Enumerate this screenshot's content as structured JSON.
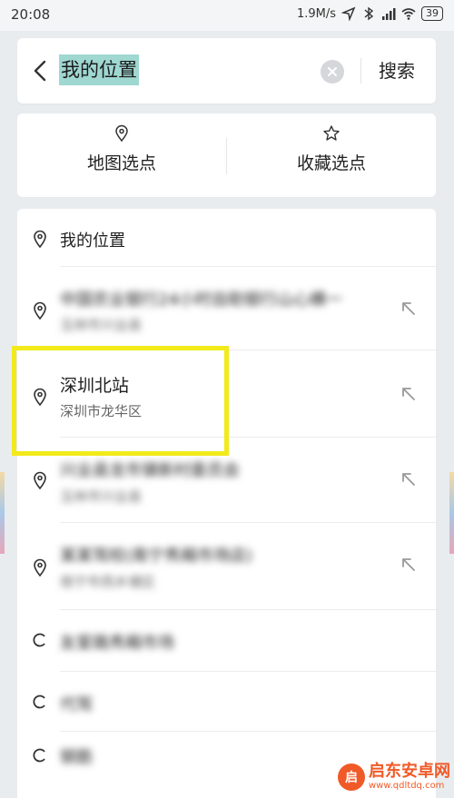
{
  "status_bar": {
    "time": "20:08",
    "speed": "1.9M/s",
    "battery": "39"
  },
  "search": {
    "back_icon": "chevron-left-icon",
    "value": "我的位置",
    "clear_icon": "close-icon",
    "button_label": "搜索"
  },
  "options": [
    {
      "label": "地图选点",
      "icon": "location-pin-icon"
    },
    {
      "label": "收藏选点",
      "icon": "star-icon"
    }
  ],
  "results": [
    {
      "title": "我的位置",
      "subtitle": "",
      "kind": "pin",
      "blurred": false,
      "arrow": false
    },
    {
      "title": "中国农业银行24小时自助银行山心横一",
      "subtitle": "玉林市兴业县",
      "kind": "pin",
      "blurred": true,
      "arrow": true
    },
    {
      "title": "深圳北站",
      "subtitle": "深圳市龙华区",
      "kind": "pin",
      "blurred": false,
      "arrow": true
    },
    {
      "title": "兴业县龙市镇新村委员会",
      "subtitle": "玉林市兴业县",
      "kind": "pin",
      "blurred": true,
      "arrow": true
    },
    {
      "title": "某某驾校(南宁秀厢市场店)",
      "subtitle": "南宁市西乡塘区",
      "kind": "pin",
      "blurred": true,
      "arrow": true
    },
    {
      "title": "友爱路秀厢市场",
      "subtitle": "",
      "kind": "clock",
      "blurred": true,
      "arrow": false
    },
    {
      "title": "代驾",
      "subtitle": "",
      "kind": "clock",
      "blurred": true,
      "arrow": false
    },
    {
      "title": "钢筋",
      "subtitle": "",
      "kind": "clock",
      "blurred": true,
      "arrow": false
    }
  ],
  "watermark": {
    "name": "启东安卓网",
    "url": "www.qdltdq.com",
    "logo_text": "启"
  },
  "colors": {
    "highlight": "#f2ea1a",
    "selection": "#9fd7d1",
    "brand": "#f05a28"
  }
}
